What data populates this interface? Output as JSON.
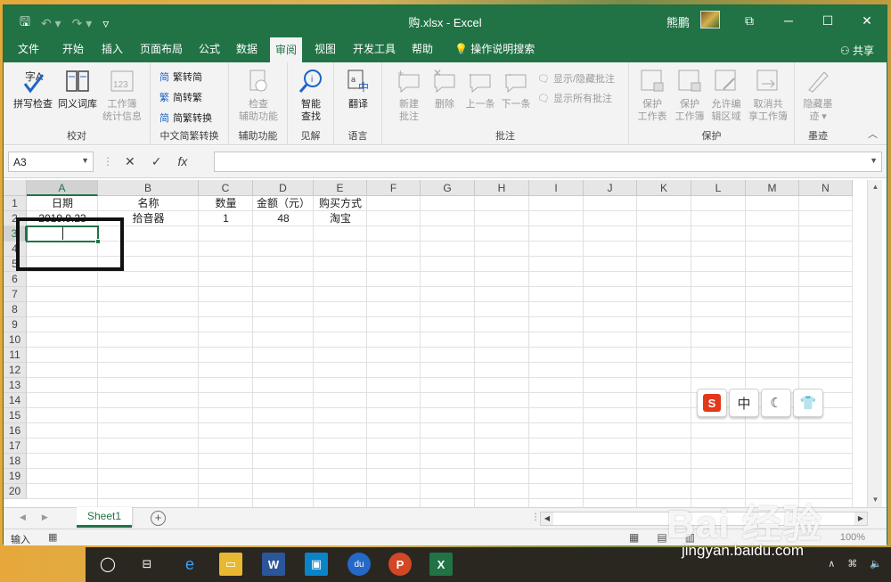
{
  "window": {
    "title": "购.xlsx  -  Excel",
    "user": "熊鹏",
    "share": "共享"
  },
  "tabs": [
    "文件",
    "开始",
    "插入",
    "页面布局",
    "公式",
    "数据",
    "审阅",
    "视图",
    "开发工具",
    "帮助"
  ],
  "active_tab": "审阅",
  "search_hint": "操作说明搜索",
  "ribbon": {
    "proofing": {
      "label": "校对",
      "spell": "拼写检查",
      "thesaurus": "同义词库",
      "stats_l1": "工作簿",
      "stats_l2": "统计信息"
    },
    "chinese": {
      "label": "中文简繁转换",
      "t2s": "繁转简",
      "s2t": "简转繁",
      "convert": "简繁转换"
    },
    "accessibility": {
      "label": "辅助功能",
      "check_l1": "检查",
      "check_l2": "辅助功能"
    },
    "insights": {
      "label": "见解",
      "lookup_l1": "智能",
      "lookup_l2": "查找"
    },
    "language": {
      "label": "语言",
      "translate": "翻译"
    },
    "comments": {
      "label": "批注",
      "new_l1": "新建",
      "new_l2": "批注",
      "delete": "删除",
      "prev": "上一条",
      "next": "下一条",
      "show_hide": "显示/隐藏批注",
      "show_all": "显示所有批注"
    },
    "protect": {
      "label": "保护",
      "sheet_l1": "保护",
      "sheet_l2": "工作表",
      "wb_l1": "保护",
      "wb_l2": "工作簿",
      "edit_l1": "允许编",
      "edit_l2": "辑区域",
      "unshare_l1": "取消共",
      "unshare_l2": "享工作簿"
    },
    "ink": {
      "label": "墨迹",
      "hide_l1": "隐藏墨",
      "hide_l2": "迹 ▾"
    }
  },
  "formula_bar": {
    "name_box": "A3",
    "formula": ""
  },
  "columns": [
    "A",
    "B",
    "C",
    "D",
    "E",
    "F",
    "G",
    "H",
    "I",
    "J",
    "K",
    "L",
    "M",
    "N"
  ],
  "rows": [
    "1",
    "2",
    "3",
    "4",
    "5",
    "6",
    "7",
    "8",
    "9",
    "10",
    "11",
    "12",
    "13",
    "14",
    "15",
    "16",
    "17",
    "18",
    "19",
    "20"
  ],
  "cells": {
    "A1": "日期",
    "B1": "名称",
    "C1": "数量",
    "D1": "金额（元）",
    "E1": "购买方式",
    "A2": "2019.9.23",
    "B2": "拾音器",
    "C2": "1",
    "D2": "48",
    "E2": "淘宝"
  },
  "sheet_tab": "Sheet1",
  "status": {
    "mode": "输入",
    "zoom": "100%"
  },
  "ime": {
    "s_label": "S",
    "lang": "中"
  },
  "watermark": {
    "logo": "Bai 经验",
    "url": "jingyan.baidu.com"
  },
  "colors": {
    "excel_green": "#217346"
  }
}
